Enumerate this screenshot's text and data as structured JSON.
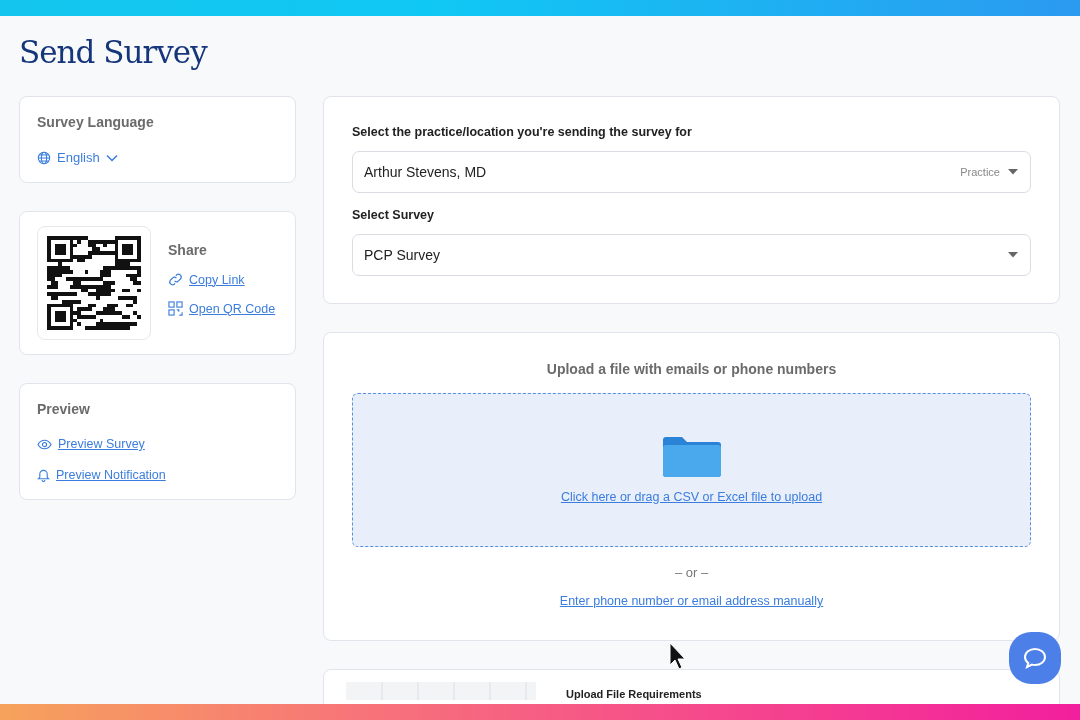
{
  "page": {
    "title": "Send Survey"
  },
  "language_card": {
    "heading": "Survey Language",
    "language": "English"
  },
  "share_card": {
    "heading": "Share",
    "links": [
      {
        "kind": "link",
        "label": "Copy Link"
      },
      {
        "kind": "qr",
        "label": "Open QR Code"
      }
    ]
  },
  "preview_card": {
    "heading": "Preview",
    "links": [
      {
        "kind": "eye",
        "label": "Preview Survey"
      },
      {
        "kind": "bell",
        "label": "Preview Notification"
      }
    ]
  },
  "selection_card": {
    "fields": [
      {
        "label": "Select the practice/location you're sending the survey for",
        "value": "Arthur Stevens, MD",
        "tag": "Practice"
      },
      {
        "label": "Select Survey",
        "value": "PCP Survey"
      }
    ]
  },
  "upload_card": {
    "heading": "Upload a file with emails or phone numbers",
    "drop_link": "Click here or drag a CSV or Excel file to upload",
    "separator": "– or –",
    "manual_link": "Enter phone number or email address manually"
  },
  "requirements_card": {
    "heading": "Upload File Requirements"
  }
}
